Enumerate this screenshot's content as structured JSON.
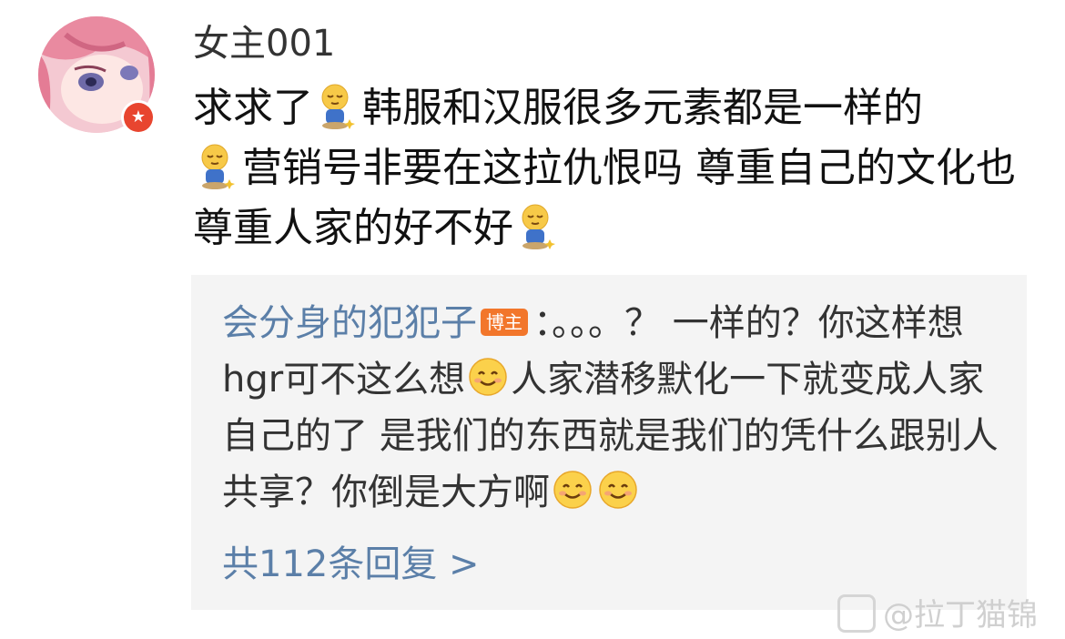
{
  "comment": {
    "username": "女主001",
    "segments": {
      "a": "求求了",
      "b": "韩服和汉服很多元素都是一样的",
      "c": "营销号非要在这拉仇恨吗 尊重自己的文化也尊重人家的好不好"
    },
    "emoji_icon": "dozing-figure-emoji"
  },
  "reply": {
    "author": "会分身的犯犯子",
    "badge": "博主",
    "text_a": "：。。。？ 一样的？你这样想hgr可不这么想",
    "text_b": "人家潜移默化一下就变成人家自己的了  是我们的东西就是我们的凭什么跟别人共享？你倒是大方啊",
    "emoji_icon": "smiling-face-emoji",
    "count_label": "共112条回复 >"
  },
  "watermark": {
    "text": "@拉丁猫锦"
  },
  "colors": {
    "link_blue": "#5b7fa8",
    "badge_orange": "#f2762b",
    "verified_red": "#e8452f",
    "reply_bg": "#f4f4f4"
  }
}
